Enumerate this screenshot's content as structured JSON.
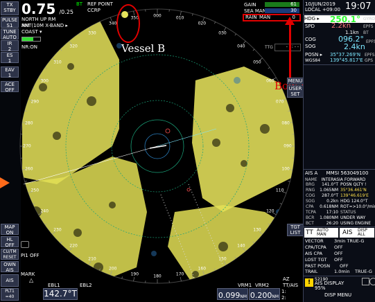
{
  "left_panel": {
    "tx_stby": "TX\nSTBY",
    "range_main": "0.75",
    "range_sub": "/0.25",
    "range_unit": "NM",
    "range_bar": "BT",
    "orientation": "NORTH UP RM",
    "pulse_label": "PULSE",
    "pulse_value": "S1",
    "antenna": "ANT(10M X-BAND",
    "tune_label": "TUNE",
    "tune_value": "AUTO",
    "coast": "COAST",
    "ir_label": "IR",
    "ir_value": "2",
    "nr": "NR:ON",
    "es_label": "ES",
    "es_value": "1",
    "eav_label": "EAV",
    "eav_value": "1",
    "ace_label": "ACE",
    "ace_value": "OFF",
    "map_label": "MAP",
    "map_value": "ON",
    "hl_label": "HL",
    "hl_value": "OFF",
    "cu_tm": "CU/TM\nRESET",
    "pi_off": "PI1 OFF",
    "own_label": "OWN",
    "own_value": "AIS",
    "mark": "MARK",
    "ais_label": "AIS",
    "plti": "PLT1\n=40",
    "ebl1_label": "EBL1",
    "ebl1_value": "142.7°T",
    "ebl2_label": "EBL2"
  },
  "top": {
    "ref_point": "REF POINT",
    "ccrp": "CCRP",
    "gain_label": "GAIN",
    "gain_value": "61",
    "sea_label": "SEA",
    "sea_mode": "MAN",
    "sea_value": "30",
    "rain_label": "RAIN",
    "rain_mode": "MAN",
    "rain_value": "0",
    "ttg": "TTG",
    "ttg_value": "- - : - -"
  },
  "radar": {
    "bearing_labels": [
      "350",
      "000",
      "010",
      "340",
      "020",
      "330",
      "030",
      "320",
      "040",
      "310",
      "050",
      "300",
      "060",
      "290",
      "070",
      "280",
      "080",
      "270",
      "090",
      "260",
      "100",
      "250",
      "110",
      "240",
      "120",
      "230",
      "130",
      "220",
      "140",
      "210",
      "150",
      "200",
      "160",
      "190",
      "180",
      "170"
    ],
    "menu": "MENU",
    "user_set": "USER\nSET",
    "tgt_list": "TGT\nLIST",
    "vrm1_label": "VRM1",
    "vrm1_value": "0.099",
    "vrm1_unit": "NM",
    "vrm2_label": "VRM2",
    "vrm2_value": "0.200",
    "vrm2_unit": "NM",
    "az_label": "AZ\nTT/AIS",
    "az_sub": "1:\n2:",
    "annotation_vessel": "Vessel B",
    "annotation_bow": "Bow Position"
  },
  "right_panel": {
    "date": "10/JUN/2019",
    "local": "LOCAL +09:00",
    "time": "19:07",
    "hdg_label": "HDG",
    "hdg_value": "250.1°",
    "hdg_src": "GYRO",
    "spd_label": "SPD",
    "spd_value": "2.2kn",
    "spd_src": "EPFS",
    "spd_sub": "1.1kn",
    "spd_sub_src": "BT",
    "cog_label": "COG",
    "cog_value": "096.2°",
    "cog_src": "EPFS",
    "sog_label": "SOG",
    "sog_value": "2.4kn",
    "posn_label": "POSN",
    "posn_lat": "35°37.269'N",
    "posn_lon": "139°45.817'E",
    "posn_src": "EPFS",
    "posn_datum": "WGS84",
    "posn_gps": "GPS",
    "ais_header": "AIS A",
    "mmsi": "MMSI 563049100",
    "name_label": "NAME",
    "name_value": "INTERASIA FORWARD",
    "brg_label": "BRG",
    "brg_value": "141.0°T",
    "posn_qlty": "POSN QLTY !",
    "rng_label": "RNG",
    "rng_value": "1.065NM",
    "t_lat": "35°36.461'N",
    "cog2_label": "COG",
    "cog2_value": "287.0°T",
    "t_lon": "139°46.619'E",
    "sog2_label": "SOG",
    "sog2_value": "0.2kn",
    "hdg2": "HDG 124.0°T",
    "cpa_label": "CPA",
    "cpa_value": "0.618NM",
    "rot": "ROT=>10.0°/min",
    "tcpa_label": "TCPA",
    "tcpa_value": "17:10",
    "status_label": "STATUS",
    "bcr_label": "BCR",
    "bcr_value": "1.080NM",
    "status_value": "UNDER WAY\nUSING ENGINE",
    "bct_label": "BCT",
    "bct_value": "26:20",
    "tt_label": "TT",
    "tt_auto": "AUTO\nMAN",
    "ais_disp": "AIS",
    "ais_disp_sub": "DISP\nALL",
    "vector_label": "VECTOR",
    "vector_value": "3min TRUE-G",
    "cpa_tcpa_label": "CPA/TCPA",
    "cpa_tcpa_value": "OFF",
    "ais_cpa_label": "AIS CPA",
    "ais_cpa_value": "OFF",
    "lost_tgt_label": "LOST TGT",
    "lost_tgt_value": "OFF",
    "past_posn_label": "PAST POSN",
    "past_posn_value": "OFF",
    "trail_label": "TRAIL",
    "trail_value": "1.0min",
    "trail_mode": "TRUE-G",
    "alert_count": "52190",
    "alert_text": "AIS DISPLAY\n95%",
    "disp_menu": "DISP MENU"
  },
  "colors": {
    "echo": "#f2f05a",
    "annotation_red": "#e10000",
    "hdg_green": "#33ff33"
  }
}
